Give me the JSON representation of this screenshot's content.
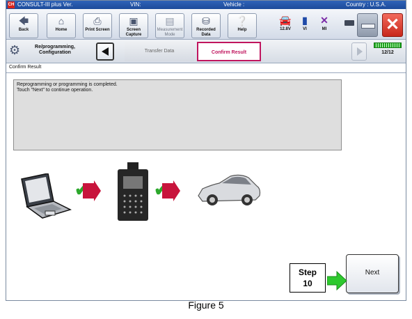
{
  "titlebar": {
    "app_icon": "CH",
    "app": "CONSULT-III plus  Ver.",
    "vin": "VIN:",
    "vehicle": "Vehicle :",
    "country": "Country : U.S.A."
  },
  "toolbar": {
    "back": "Back",
    "home": "Home",
    "print_screen": "Print Screen",
    "screen_capture": "Screen Capture",
    "measurement_mode": "Measurement Mode",
    "recorded_data": "Recorded Data",
    "help": "Help"
  },
  "status": {
    "voltage": "12.8V",
    "vi": "VI",
    "mi": "MI"
  },
  "breadcrumb": {
    "section": "Re/programming, Configuration",
    "step_transfer": "Transfer Data",
    "step_confirm": "Confirm Result",
    "progress": "12/12",
    "progress_fraction": 1.0
  },
  "main": {
    "section_title": "Confirm Result",
    "message_lines": [
      "Reprogramming or programming is completed.",
      "Touch \"Next\" to continue operation."
    ],
    "next_label": "Next"
  },
  "annotation": {
    "step_label": "Step",
    "step_number": "10"
  },
  "caption": "Figure 5",
  "icons": [
    "back-icon",
    "home-icon",
    "printer-icon",
    "camera-icon",
    "measurement-icon",
    "recorded-data-icon",
    "help-icon",
    "car-icon",
    "vi-icon",
    "mi-icon",
    "battery-icon",
    "close-icon",
    "reprogramming-icon",
    "check-icon",
    "laptop-icon",
    "vi-unit-icon",
    "vehicle-icon"
  ],
  "colors": {
    "accent": "#c0155e",
    "titlebar": "#2f63b8",
    "check": "#2ca82c",
    "arrow_red": "#c8143c",
    "arrow_green": "#2ec92e",
    "close": "#d8372a"
  }
}
